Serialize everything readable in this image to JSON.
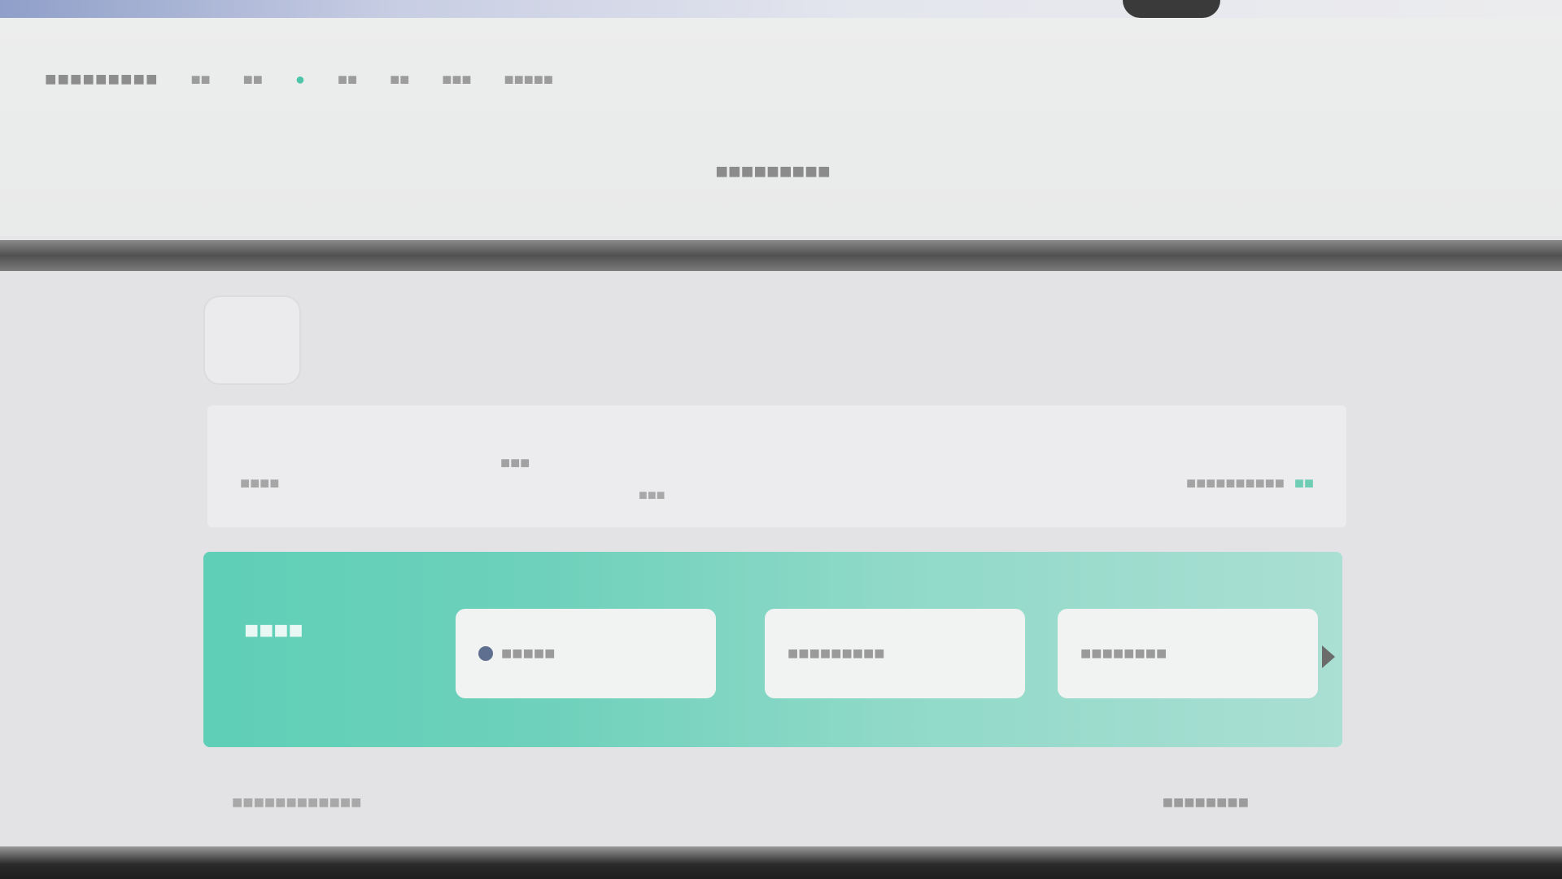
{
  "nav": {
    "brand": "■■■■■■■■■",
    "items": [
      "■■",
      "■■",
      "●",
      "■■",
      "■■",
      "■■■",
      "■■■■■"
    ]
  },
  "page": {
    "subtitle": "■■■■■■■■■"
  },
  "logo": {
    "label": "■■■"
  },
  "header": {
    "left": "■■■■",
    "mid1": "■■■",
    "mid2": "■■■",
    "right_text": "■■■■■■■■■■",
    "right_link": "■■"
  },
  "search": {
    "title": "■■■■",
    "field1": "■■■■■",
    "field2": "■■■■■■■■■",
    "field3": "■■■■■■■■"
  },
  "bottom": {
    "left": "■■■■■■■■■■■■",
    "right": "■■■■■■■■"
  },
  "colors": {
    "accent": "#5fcfb7",
    "nav_active": "#4cc5a8"
  }
}
